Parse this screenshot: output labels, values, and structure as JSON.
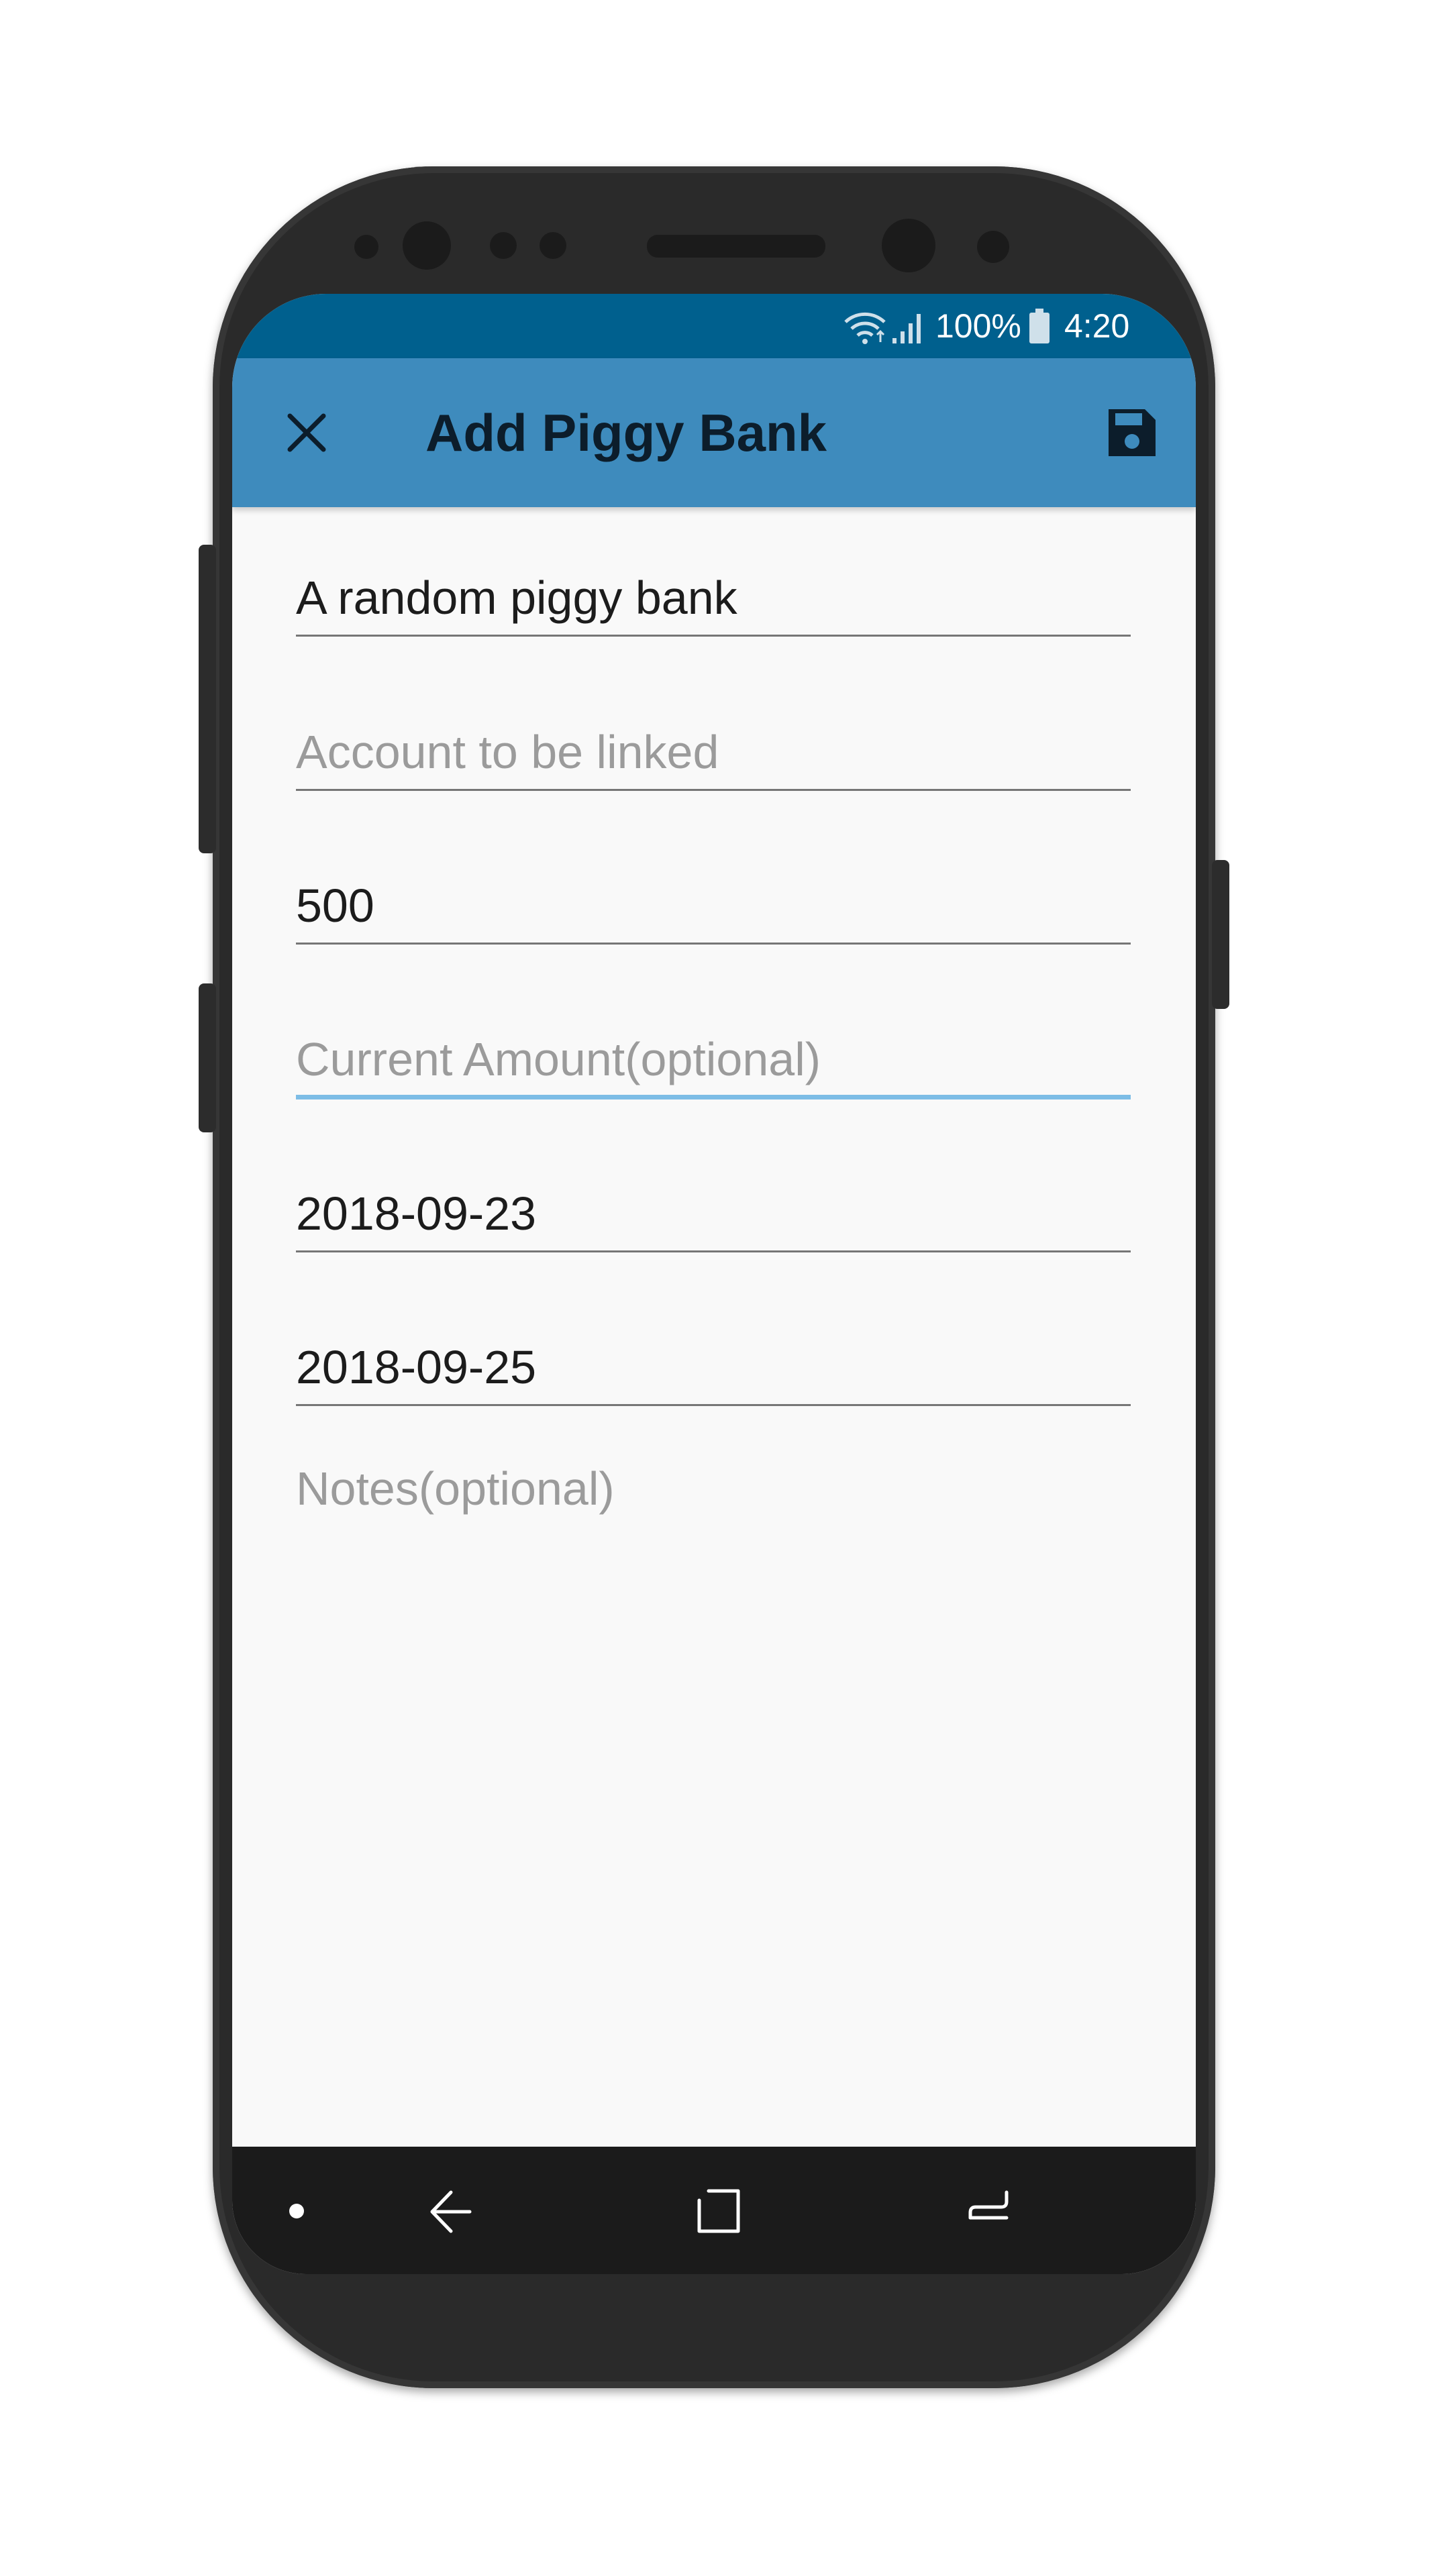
{
  "status_bar": {
    "battery": "100%",
    "time": "4:20",
    "icons": [
      "wifi-icon",
      "signal-icon",
      "battery-icon"
    ]
  },
  "app_bar": {
    "title": "Add Piggy Bank",
    "close_icon": "close-icon",
    "save_icon": "save-icon"
  },
  "form": {
    "name": {
      "value": "A random piggy bank",
      "placeholder": ""
    },
    "account": {
      "value": "",
      "placeholder": "Account to be linked"
    },
    "target_amount": {
      "value": "500",
      "placeholder": ""
    },
    "current_amount": {
      "value": "",
      "placeholder": "Current Amount(optional)"
    },
    "start_date": {
      "value": "2018-09-23",
      "placeholder": ""
    },
    "target_date": {
      "value": "2018-09-25",
      "placeholder": ""
    },
    "notes": {
      "value": "",
      "placeholder": "Notes(optional)"
    }
  },
  "nav_bar": {
    "icons": [
      "dot-icon",
      "back-icon",
      "recents-icon",
      "switch-icon"
    ]
  },
  "colors": {
    "status_bar": "#00608e",
    "app_bar": "#3e8bbd",
    "focus_underline": "#7dbde6",
    "background": "#f9f9f9"
  }
}
